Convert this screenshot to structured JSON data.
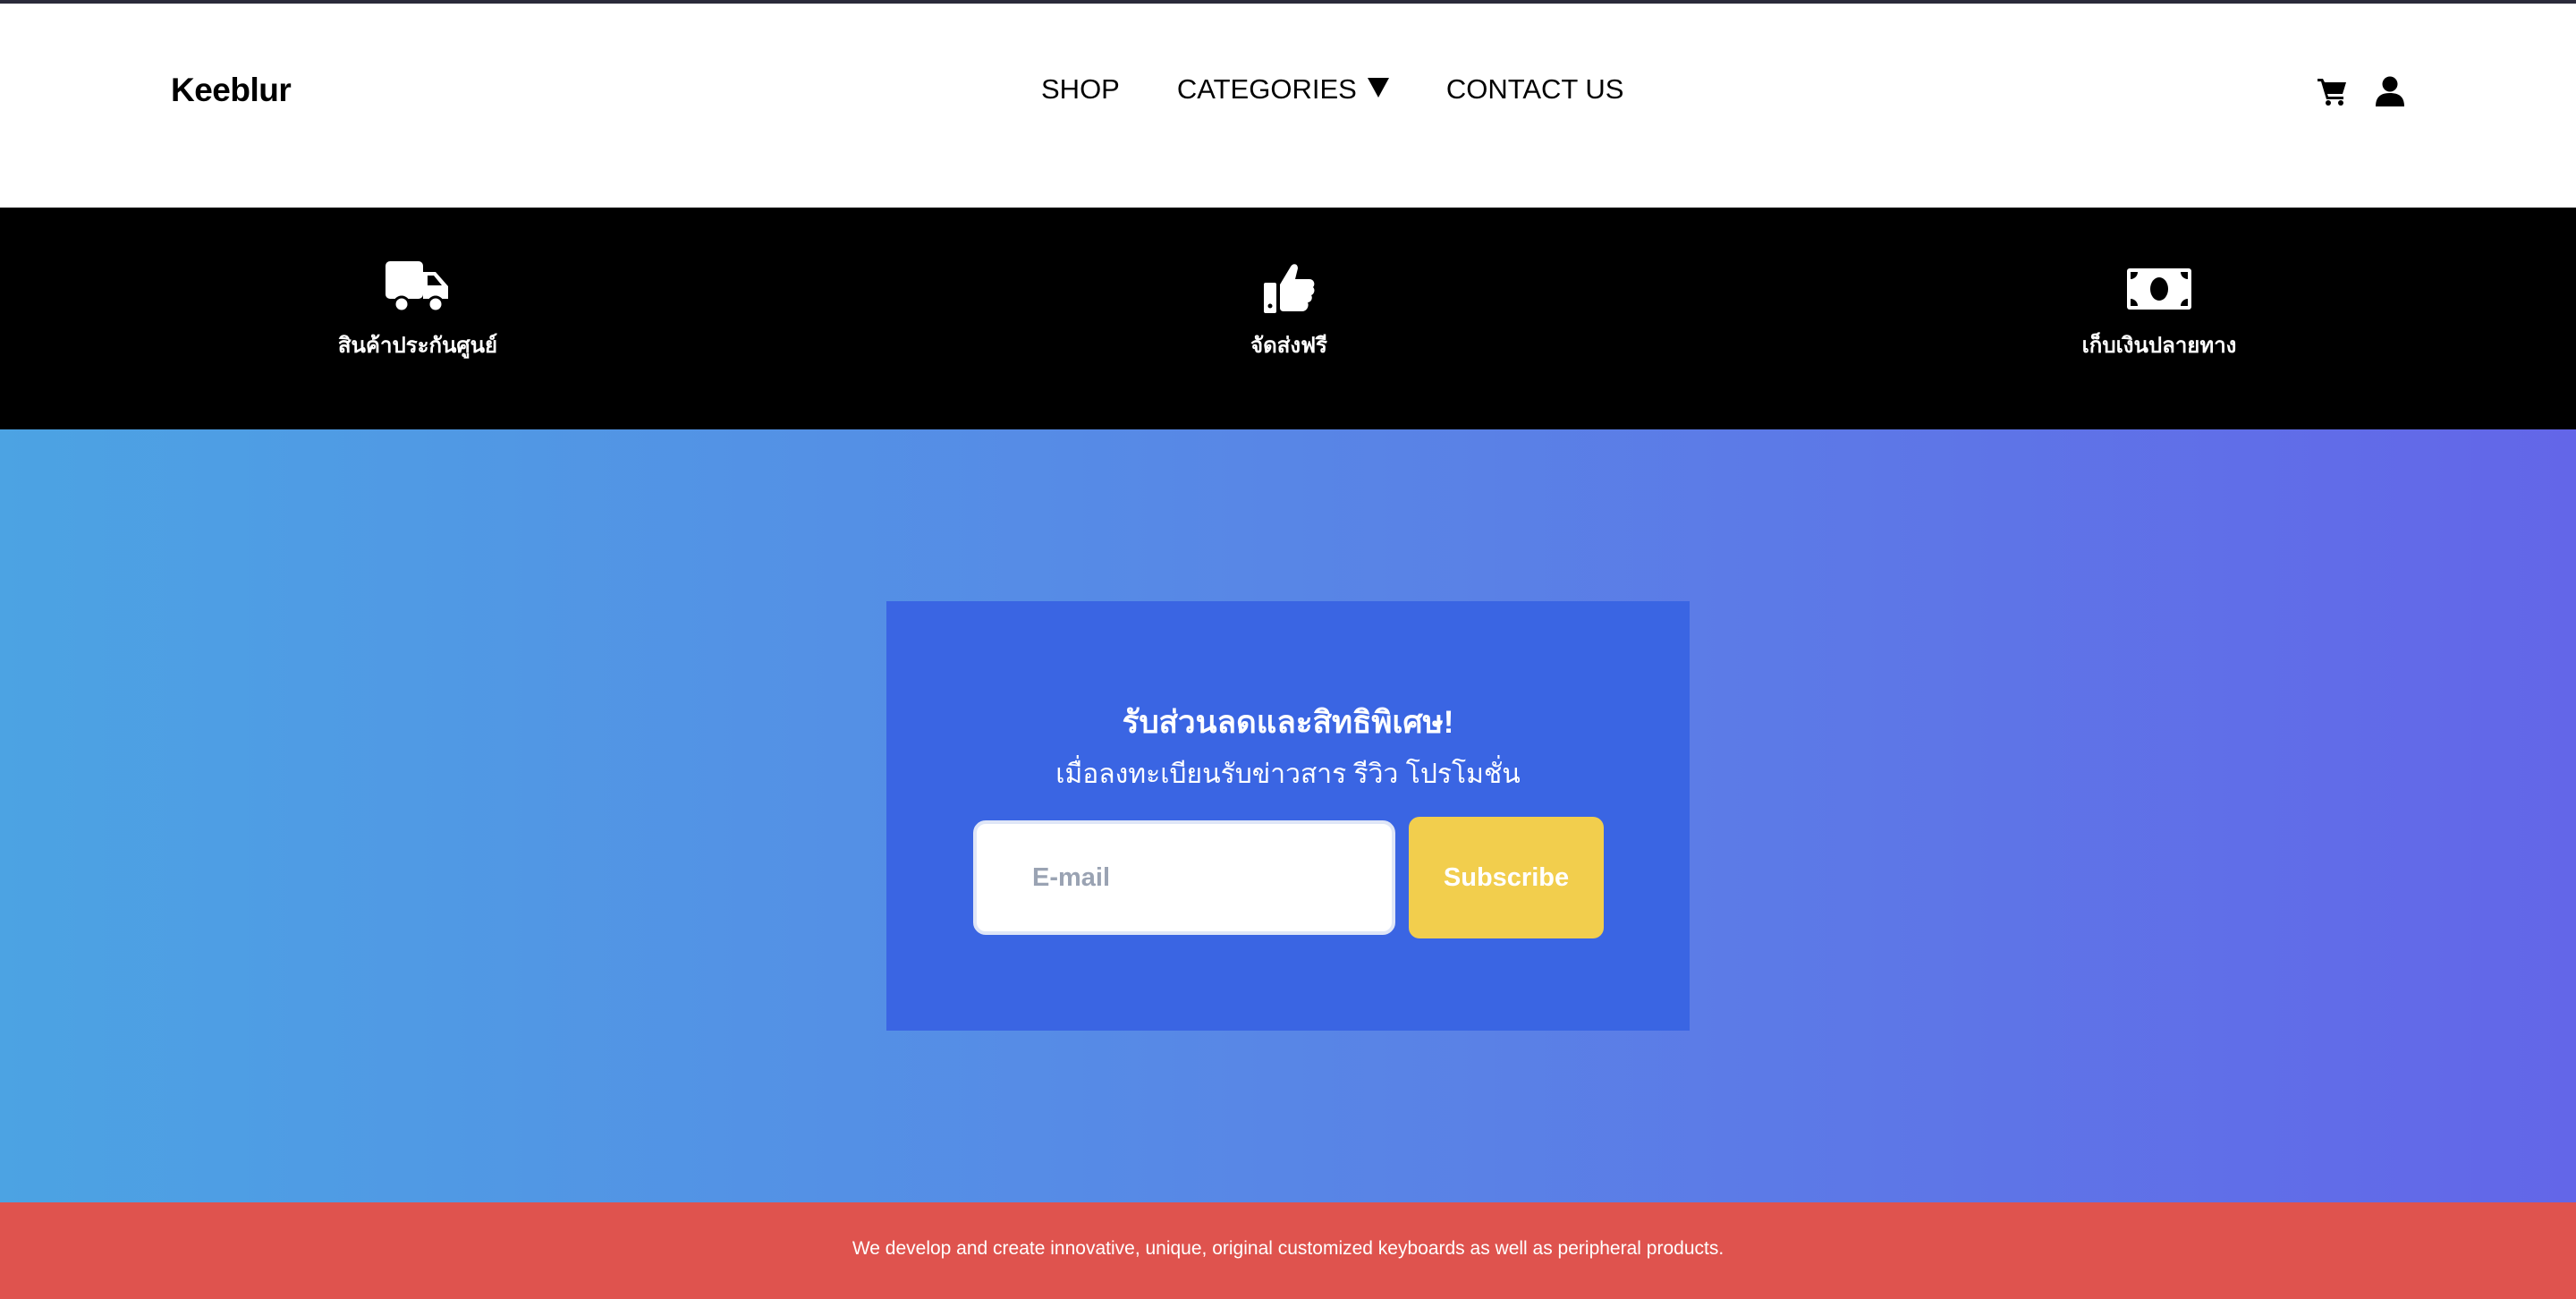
{
  "header": {
    "logo": "Keeblur",
    "nav": [
      {
        "label": "SHOP"
      },
      {
        "label": "CATEGORIES"
      },
      {
        "label": "CONTACT US"
      }
    ],
    "icons": [
      "cart-icon",
      "user-icon"
    ]
  },
  "features": [
    {
      "icon": "truck-icon",
      "label": "สินค้าประกันศูนย์"
    },
    {
      "icon": "thumbs-up-icon",
      "label": "จัดส่งฟรี"
    },
    {
      "icon": "money-bill-icon",
      "label": "เก็บเงินปลายทาง"
    }
  ],
  "newsletter": {
    "title": "รับส่วนลดและสิทธิพิเศษ!",
    "subtitle": "เมื่อลงทะเบียนรับข่าวสาร รีวิว โปรโมชั่น",
    "email_placeholder": "E-mail",
    "email_value": "",
    "subscribe_label": "Subscribe"
  },
  "footer": {
    "text": "We develop and create innovative, unique, original customized keyboards as well as peripheral products."
  },
  "colors": {
    "feature_strip": "#000000",
    "card": "#3a65e3",
    "subscribe_button": "#f2ce4d",
    "footer": "#df534e",
    "gradient_start": "#4ca3e3",
    "gradient_end": "#6366e8"
  }
}
